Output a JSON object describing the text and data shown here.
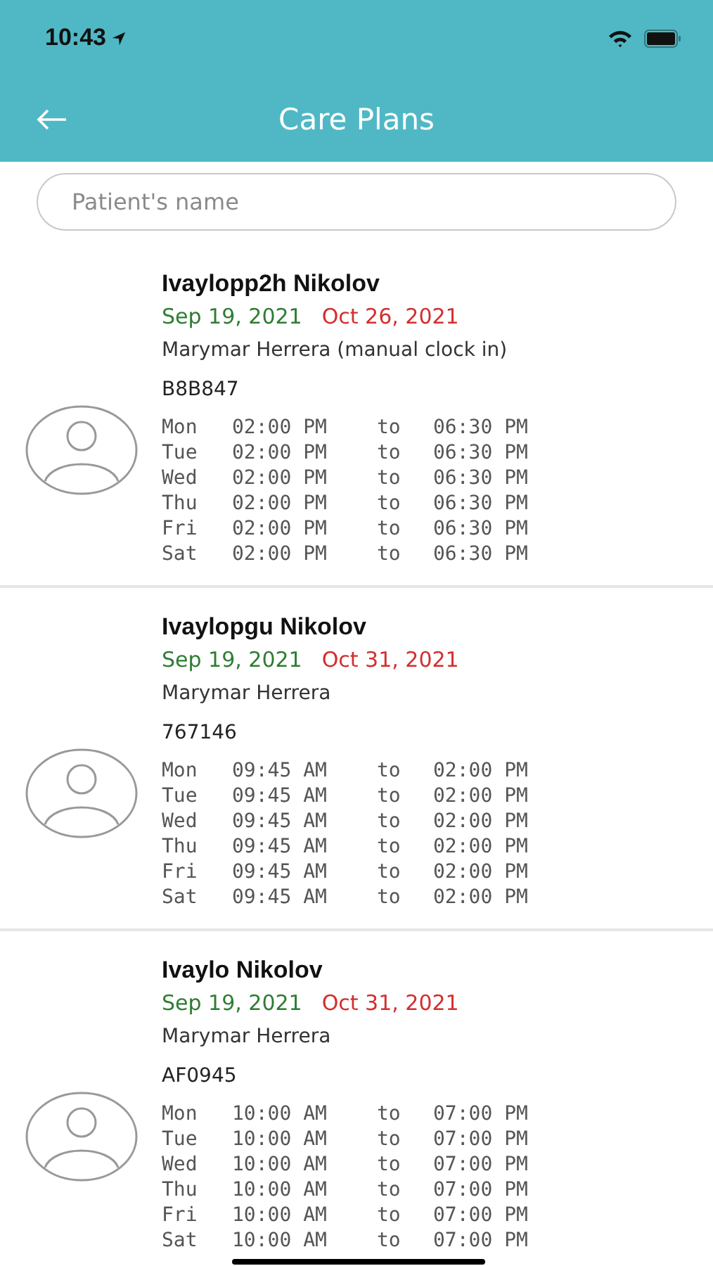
{
  "status_bar": {
    "time": "10:43"
  },
  "nav": {
    "title": "Care Plans"
  },
  "search": {
    "placeholder": "Patient's name"
  },
  "plans": [
    {
      "name": "Ivaylopp2h Nikolov",
      "start_date": "Sep 19, 2021",
      "end_date": "Oct 26, 2021",
      "caregiver": "Marymar Herrera (manual clock in)",
      "code": "B8B847",
      "schedule": [
        {
          "day": "Mon",
          "from": "02:00 PM",
          "sep": "to",
          "to": "06:30 PM"
        },
        {
          "day": "Tue",
          "from": "02:00 PM",
          "sep": "to",
          "to": "06:30 PM"
        },
        {
          "day": "Wed",
          "from": "02:00 PM",
          "sep": "to",
          "to": "06:30 PM"
        },
        {
          "day": "Thu",
          "from": "02:00 PM",
          "sep": "to",
          "to": "06:30 PM"
        },
        {
          "day": "Fri",
          "from": "02:00 PM",
          "sep": "to",
          "to": "06:30 PM"
        },
        {
          "day": "Sat",
          "from": "02:00 PM",
          "sep": "to",
          "to": "06:30 PM"
        }
      ]
    },
    {
      "name": "Ivaylopgu Nikolov",
      "start_date": "Sep 19, 2021",
      "end_date": "Oct 31, 2021",
      "caregiver": "Marymar Herrera",
      "code": "767146",
      "schedule": [
        {
          "day": "Mon",
          "from": "09:45 AM",
          "sep": "to",
          "to": "02:00 PM"
        },
        {
          "day": "Tue",
          "from": "09:45 AM",
          "sep": "to",
          "to": "02:00 PM"
        },
        {
          "day": "Wed",
          "from": "09:45 AM",
          "sep": "to",
          "to": "02:00 PM"
        },
        {
          "day": "Thu",
          "from": "09:45 AM",
          "sep": "to",
          "to": "02:00 PM"
        },
        {
          "day": "Fri",
          "from": "09:45 AM",
          "sep": "to",
          "to": "02:00 PM"
        },
        {
          "day": "Sat",
          "from": "09:45 AM",
          "sep": "to",
          "to": "02:00 PM"
        }
      ]
    },
    {
      "name": "Ivaylo Nikolov",
      "start_date": "Sep 19, 2021",
      "end_date": "Oct 31, 2021",
      "caregiver": "Marymar Herrera",
      "code": "AF0945",
      "schedule": [
        {
          "day": "Mon",
          "from": "10:00 AM",
          "sep": "to",
          "to": "07:00 PM"
        },
        {
          "day": "Tue",
          "from": "10:00 AM",
          "sep": "to",
          "to": "07:00 PM"
        },
        {
          "day": "Wed",
          "from": "10:00 AM",
          "sep": "to",
          "to": "07:00 PM"
        },
        {
          "day": "Thu",
          "from": "10:00 AM",
          "sep": "to",
          "to": "07:00 PM"
        },
        {
          "day": "Fri",
          "from": "10:00 AM",
          "sep": "to",
          "to": "07:00 PM"
        },
        {
          "day": "Sat",
          "from": "10:00 AM",
          "sep": "to",
          "to": "07:00 PM"
        }
      ]
    }
  ]
}
